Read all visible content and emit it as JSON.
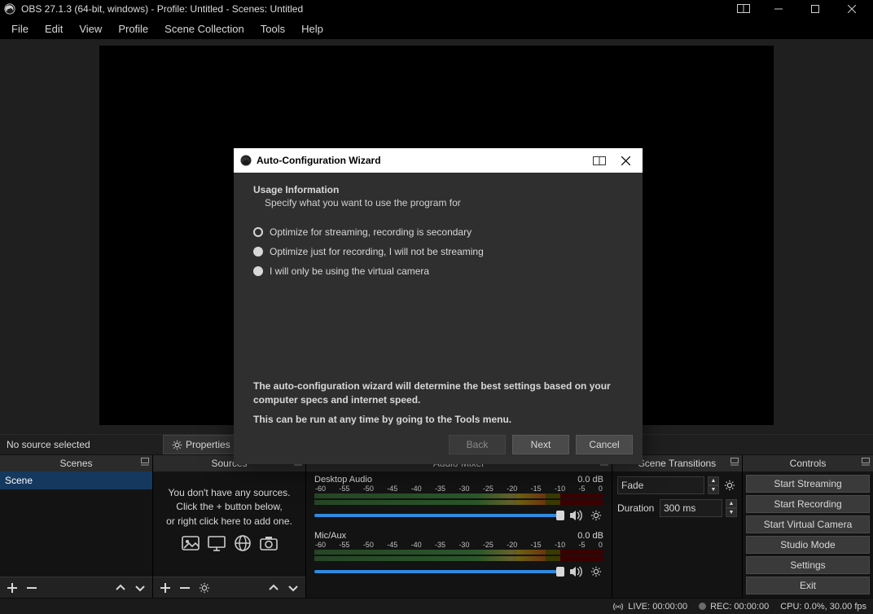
{
  "titlebar": {
    "title": "OBS 27.1.3 (64-bit, windows) - Profile: Untitled - Scenes: Untitled"
  },
  "menubar": [
    "File",
    "Edit",
    "View",
    "Profile",
    "Scene Collection",
    "Tools",
    "Help"
  ],
  "context": {
    "no_source": "No source selected",
    "properties": "Properties"
  },
  "panels": {
    "scenes_title": "Scenes",
    "sources_title": "Sources",
    "mixer_title": "Audio Mixer",
    "transitions_title": "Scene Transitions",
    "controls_title": "Controls"
  },
  "scenes": [
    {
      "name": "Scene",
      "active": true
    }
  ],
  "sources_empty": {
    "line1": "You don't have any sources.",
    "line2": "Click the + button below,",
    "line3": "or right click here to add one."
  },
  "mixer": {
    "scale": [
      "-60",
      "-55",
      "-50",
      "-45",
      "-40",
      "-35",
      "-30",
      "-25",
      "-20",
      "-15",
      "-10",
      "-5",
      "0"
    ],
    "channels": [
      {
        "name": "Desktop Audio",
        "level": "0.0 dB"
      },
      {
        "name": "Mic/Aux",
        "level": "0.0 dB"
      }
    ]
  },
  "transitions": {
    "selected": "Fade",
    "duration_label": "Duration",
    "duration_value": "300 ms"
  },
  "controls": {
    "buttons": [
      "Start Streaming",
      "Start Recording",
      "Start Virtual Camera",
      "Studio Mode",
      "Settings",
      "Exit"
    ]
  },
  "statusbar": {
    "live": "LIVE: 00:00:00",
    "rec": "REC: 00:00:00",
    "cpu": "CPU: 0.0%, 30.00 fps"
  },
  "modal": {
    "title": "Auto-Configuration Wizard",
    "heading": "Usage Information",
    "subheading": "Specify what you want to use the program for",
    "options": [
      "Optimize for streaming, recording is secondary",
      "Optimize just for recording, I will not be streaming",
      "I will only be using the virtual camera"
    ],
    "info1": "The auto-configuration wizard will determine the best settings based on your computer specs and internet speed.",
    "info2": "This can be run at any time by going to the Tools menu.",
    "back": "Back",
    "next": "Next",
    "cancel": "Cancel"
  }
}
